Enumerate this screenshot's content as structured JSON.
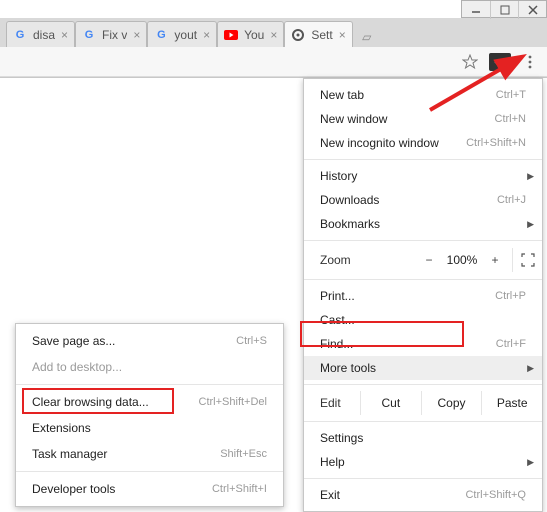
{
  "tabs": [
    {
      "title": "disa",
      "favicon": "google"
    },
    {
      "title": "Fix v",
      "favicon": "google"
    },
    {
      "title": "yout",
      "favicon": "google"
    },
    {
      "title": "You",
      "favicon": "youtube"
    },
    {
      "title": "Sett",
      "favicon": "gear",
      "active": true
    }
  ],
  "toolbar": {
    "star_icon": "star-icon",
    "ext_icon": "extension-icon",
    "menu_icon": "menu-vertical-dots"
  },
  "menu": {
    "new_tab": {
      "label": "New tab",
      "shortcut": "Ctrl+T"
    },
    "new_window": {
      "label": "New window",
      "shortcut": "Ctrl+N"
    },
    "incognito": {
      "label": "New incognito window",
      "shortcut": "Ctrl+Shift+N"
    },
    "history": {
      "label": "History"
    },
    "downloads": {
      "label": "Downloads",
      "shortcut": "Ctrl+J"
    },
    "bookmarks": {
      "label": "Bookmarks"
    },
    "zoom": {
      "label": "Zoom",
      "value": "100%",
      "minus": "−",
      "plus": "+"
    },
    "print": {
      "label": "Print...",
      "shortcut": "Ctrl+P"
    },
    "cast": {
      "label": "Cast..."
    },
    "find": {
      "label": "Find...",
      "shortcut": "Ctrl+F"
    },
    "more_tools": {
      "label": "More tools"
    },
    "edit": {
      "label": "Edit",
      "cut": "Cut",
      "copy": "Copy",
      "paste": "Paste"
    },
    "settings": {
      "label": "Settings"
    },
    "help": {
      "label": "Help"
    },
    "exit": {
      "label": "Exit",
      "shortcut": "Ctrl+Shift+Q"
    }
  },
  "submenu": {
    "save_page": {
      "label": "Save page as...",
      "shortcut": "Ctrl+S"
    },
    "add_desktop": {
      "label": "Add to desktop..."
    },
    "clear_data": {
      "label": "Clear browsing data...",
      "shortcut": "Ctrl+Shift+Del"
    },
    "extensions": {
      "label": "Extensions"
    },
    "task_mgr": {
      "label": "Task manager",
      "shortcut": "Shift+Esc"
    },
    "dev_tools": {
      "label": "Developer tools",
      "shortcut": "Ctrl+Shift+I"
    }
  }
}
